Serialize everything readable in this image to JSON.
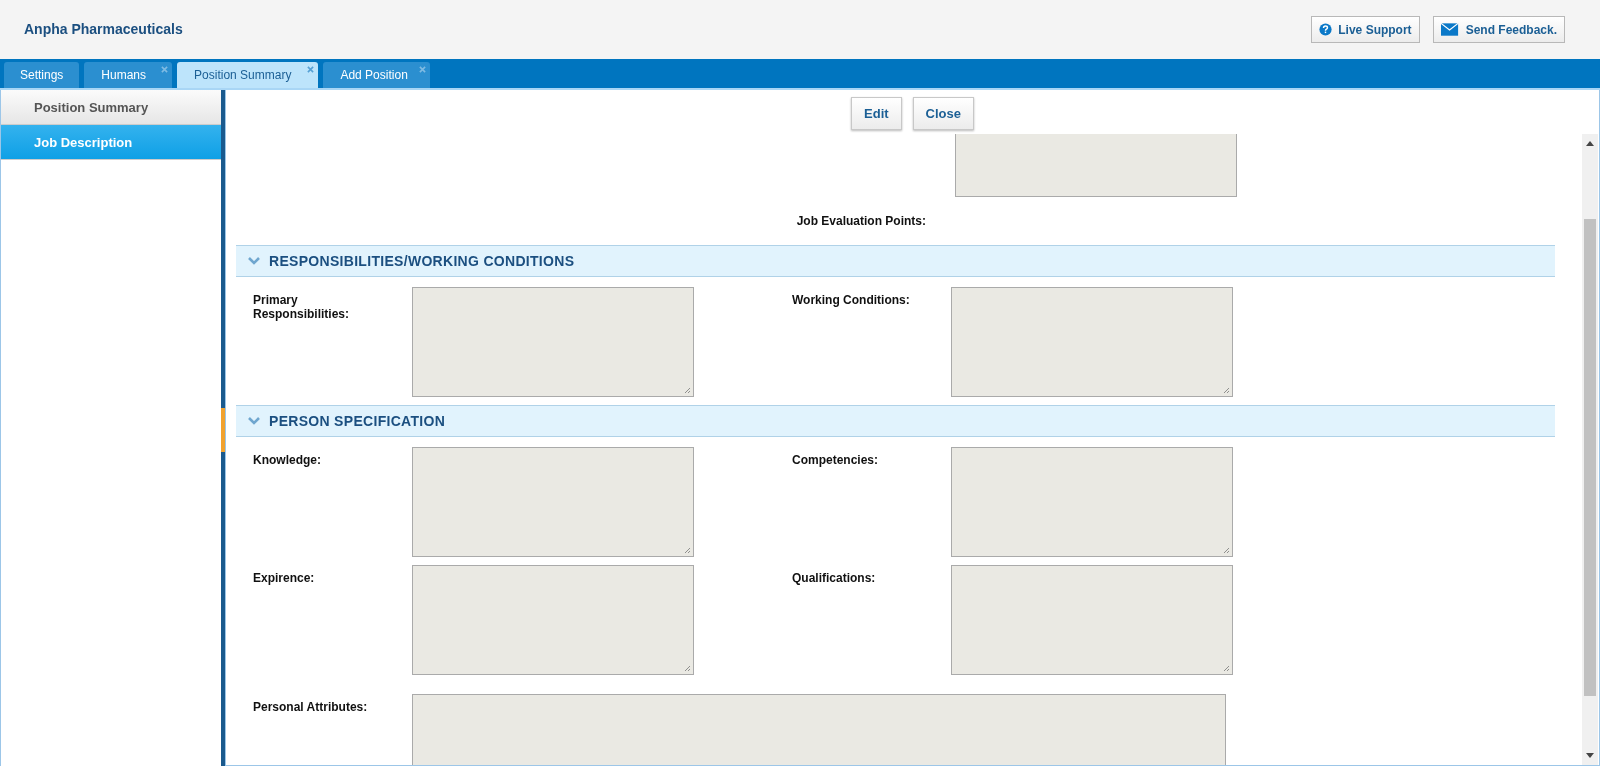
{
  "header": {
    "title": "Anpha Pharmaceuticals",
    "buttons": [
      {
        "kind": "help",
        "label": "Live Support"
      },
      {
        "kind": "mail",
        "label": "Send Feedback."
      }
    ]
  },
  "tabs": [
    {
      "label": "Settings",
      "selected": false,
      "closable": false
    },
    {
      "label": "Humans",
      "selected": false,
      "closable": true
    },
    {
      "label": "Position Summary",
      "selected": true,
      "closable": true
    },
    {
      "label": "Add Position",
      "selected": false,
      "closable": true
    }
  ],
  "sidebar": {
    "items": [
      {
        "label": "Position Summary",
        "selected": false
      },
      {
        "label": "Job Description",
        "selected": true
      }
    ]
  },
  "actions": [
    "Edit",
    "Close"
  ],
  "evaluation_label": "Job Evaluation Points:",
  "sections": [
    {
      "title": "RESPONSIBILITIES/WORKING CONDITIONS",
      "expanded": true,
      "rows": [
        [
          {
            "label": "Primary Responsibilities:",
            "kind": "textarea"
          },
          {
            "label": "Working Conditions:",
            "kind": "textarea"
          }
        ]
      ]
    },
    {
      "title": "PERSON SPECIFICATION",
      "expanded": true,
      "rows": [
        [
          {
            "label": "Knowledge:",
            "kind": "textarea"
          },
          {
            "label": "Competencies:",
            "kind": "textarea"
          }
        ],
        [
          {
            "label": "Expirence:",
            "kind": "textarea"
          },
          {
            "label": "Qualifications:",
            "kind": "textarea"
          }
        ],
        [
          {
            "label": "Personal Attributes:",
            "kind": "wide"
          }
        ]
      ]
    }
  ]
}
